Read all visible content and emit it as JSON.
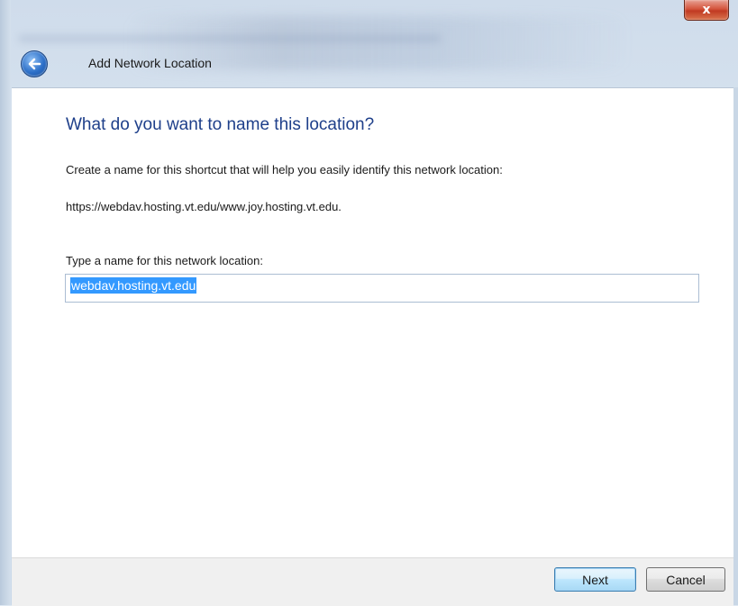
{
  "window": {
    "title": "Add Network Location",
    "close_label": "x"
  },
  "icons": {
    "back": "back-arrow-icon",
    "close": "close-icon"
  },
  "content": {
    "heading": "What do you want to name this location?",
    "description": "Create a name for this shortcut that will help you easily identify this network location:",
    "url": "https://webdav.hosting.vt.edu/www.joy.hosting.vt.edu.",
    "field_label": "Type a name for this network location:",
    "field_value": "webdav.hosting.vt.edu"
  },
  "footer": {
    "next_label": "Next",
    "cancel_label": "Cancel"
  },
  "colors": {
    "heading": "#1e3f8a",
    "selection": "#3399ff"
  }
}
